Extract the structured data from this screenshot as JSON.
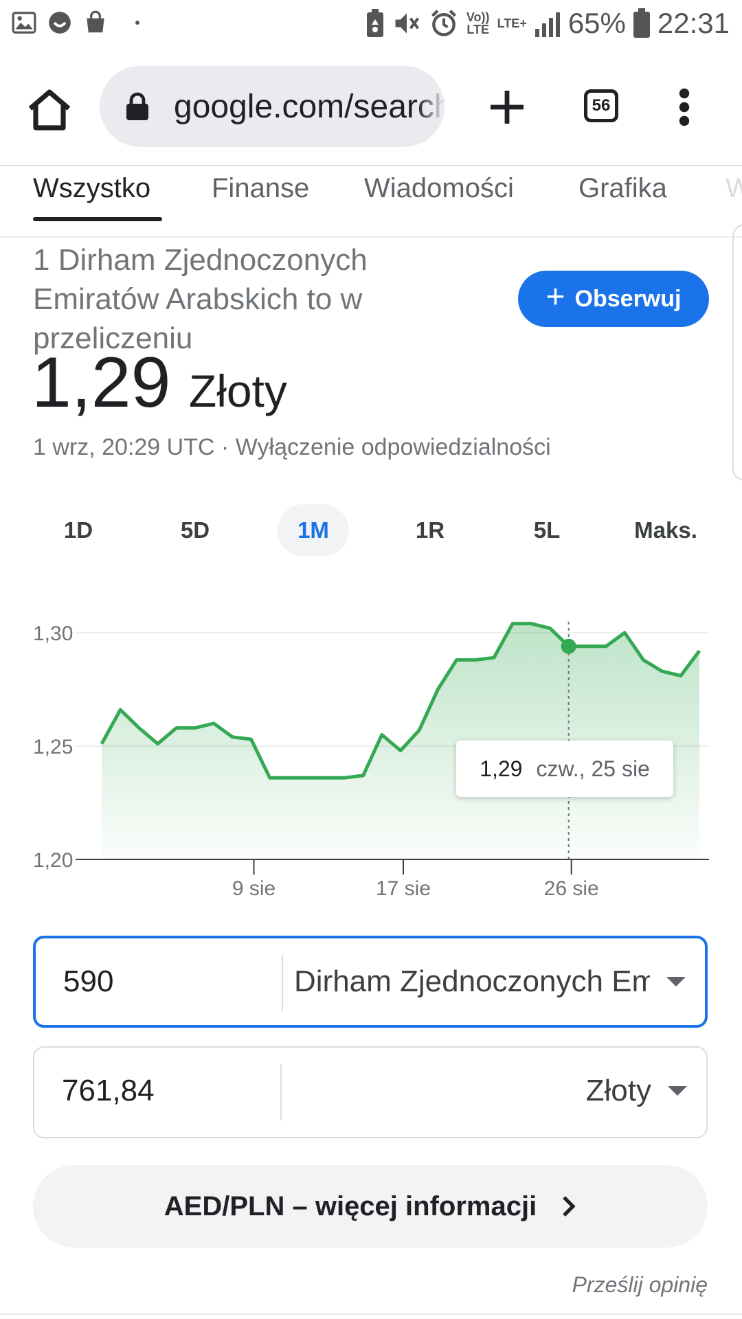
{
  "status_bar": {
    "left_icons": [
      "image-icon",
      "smiley-icon",
      "bag-icon",
      "dot-icon"
    ],
    "right_icons": [
      "battery-saver-icon",
      "mute-icon",
      "alarm-icon",
      "volte-icon",
      "lte-plus-icon",
      "signal-icon",
      "battery-icon"
    ],
    "volte_label": "Vo)) LTE",
    "lte_label": "LTE+",
    "battery": "65%",
    "time": "22:31"
  },
  "browser": {
    "url": "google.com/search",
    "tab_count": "56"
  },
  "search_tabs": [
    "Wszystko",
    "Finanse",
    "Wiadomości",
    "Grafika",
    "W"
  ],
  "converter_header": {
    "title": "1 Dirham Zjednoczonych Emiratów Arabskich to w przeliczeniu",
    "follow_label": "Obserwuj",
    "rate_value": "1,29",
    "rate_currency": "Złoty",
    "meta": "1 wrz, 20:29 UTC · Wyłączenie odpowiedzialności"
  },
  "ranges": [
    "1D",
    "5D",
    "1M",
    "1R",
    "5L",
    "Maks."
  ],
  "active_range": "1M",
  "tooltip": {
    "value": "1,29",
    "date": "czw., 25 sie"
  },
  "chart_data": {
    "type": "area",
    "y_ticks": [
      "1,30",
      "1,25",
      "1,20"
    ],
    "x_ticks": [
      "9 sie",
      "17 sie",
      "26 sie"
    ],
    "ylim": [
      1.2,
      1.3
    ],
    "color": "#34a853",
    "values": [
      1.251,
      1.266,
      1.258,
      1.251,
      1.258,
      1.258,
      1.26,
      1.254,
      1.253,
      1.236,
      1.236,
      1.236,
      1.236,
      1.236,
      1.237,
      1.255,
      1.248,
      1.257,
      1.275,
      1.288,
      1.288,
      1.289,
      1.304,
      1.304,
      1.302,
      1.294,
      1.294,
      1.294,
      1.3,
      1.288,
      1.283,
      1.281,
      1.292
    ],
    "highlight_index": 25
  },
  "converter": {
    "from_amount": "590",
    "from_currency": "Dirham Zjednoczonych Emiratów Arabskich",
    "to_amount": "761,84",
    "to_currency": "Złoty"
  },
  "more_info_label": "AED/PLN – więcej informacji",
  "feedback_label": "Prześlij opinię"
}
